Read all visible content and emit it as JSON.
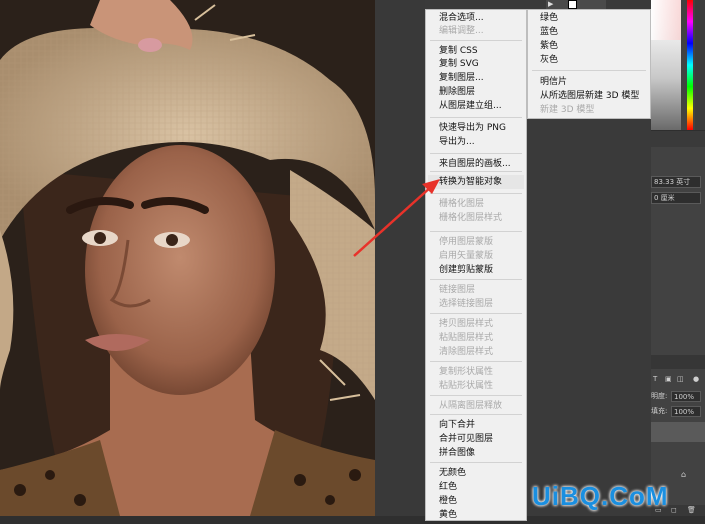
{
  "context_menu": {
    "items": [
      {
        "label": "混合选项...",
        "enabled": true
      },
      {
        "label": "编辑调整...",
        "enabled": false
      },
      {
        "label": "复制 CSS",
        "enabled": true
      },
      {
        "label": "复制 SVG",
        "enabled": true
      },
      {
        "label": "复制图层...",
        "enabled": true
      },
      {
        "label": "删除图层",
        "enabled": true
      },
      {
        "label": "从图层建立组...",
        "enabled": true
      },
      {
        "label": "快速导出为 PNG",
        "enabled": true
      },
      {
        "label": "导出为...",
        "enabled": true
      },
      {
        "label": "来自图层的画板...",
        "enabled": true
      },
      {
        "label": "转换为智能对象",
        "enabled": true
      },
      {
        "label": "栅格化图层",
        "enabled": false
      },
      {
        "label": "栅格化图层样式",
        "enabled": false
      },
      {
        "label": "停用图层蒙版",
        "enabled": false
      },
      {
        "label": "启用矢量蒙版",
        "enabled": false
      },
      {
        "label": "创建剪贴蒙版",
        "enabled": true
      },
      {
        "label": "链接图层",
        "enabled": false
      },
      {
        "label": "选择链接图层",
        "enabled": false
      },
      {
        "label": "拷贝图层样式",
        "enabled": false
      },
      {
        "label": "粘贴图层样式",
        "enabled": false
      },
      {
        "label": "清除图层样式",
        "enabled": false
      },
      {
        "label": "复制形状属性",
        "enabled": false
      },
      {
        "label": "粘贴形状属性",
        "enabled": false
      },
      {
        "label": "从隔离图层释放",
        "enabled": false
      },
      {
        "label": "向下合并",
        "enabled": true
      },
      {
        "label": "合并可见图层",
        "enabled": true
      },
      {
        "label": "拼合图像",
        "enabled": true
      },
      {
        "label": "无颜色",
        "enabled": true
      },
      {
        "label": "红色",
        "enabled": true
      },
      {
        "label": "橙色",
        "enabled": true
      },
      {
        "label": "黄色",
        "enabled": true
      }
    ]
  },
  "submenu": {
    "items": [
      {
        "label": "绿色",
        "enabled": true
      },
      {
        "label": "蓝色",
        "enabled": true
      },
      {
        "label": "紫色",
        "enabled": true
      },
      {
        "label": "灰色",
        "enabled": true
      },
      {
        "label": "明信片",
        "enabled": true
      },
      {
        "label": "从所选图层新建 3D 模型",
        "enabled": true
      },
      {
        "label": "新建 3D 模型",
        "enabled": false
      }
    ]
  },
  "properties_panel": {
    "width_value": "83.33 英寸",
    "height_value": "0 厘米"
  },
  "layers_panel": {
    "opacity_label": "明度:",
    "opacity_value": "100%",
    "fill_label": "填充:",
    "fill_value": "100%"
  },
  "watermark": "UiBQ.CoM",
  "colors": {
    "menu_bg": "#f0f0f0",
    "arrow": "#e8322a",
    "watermark": "#1a8fe0",
    "panel_bg": "#424242"
  }
}
